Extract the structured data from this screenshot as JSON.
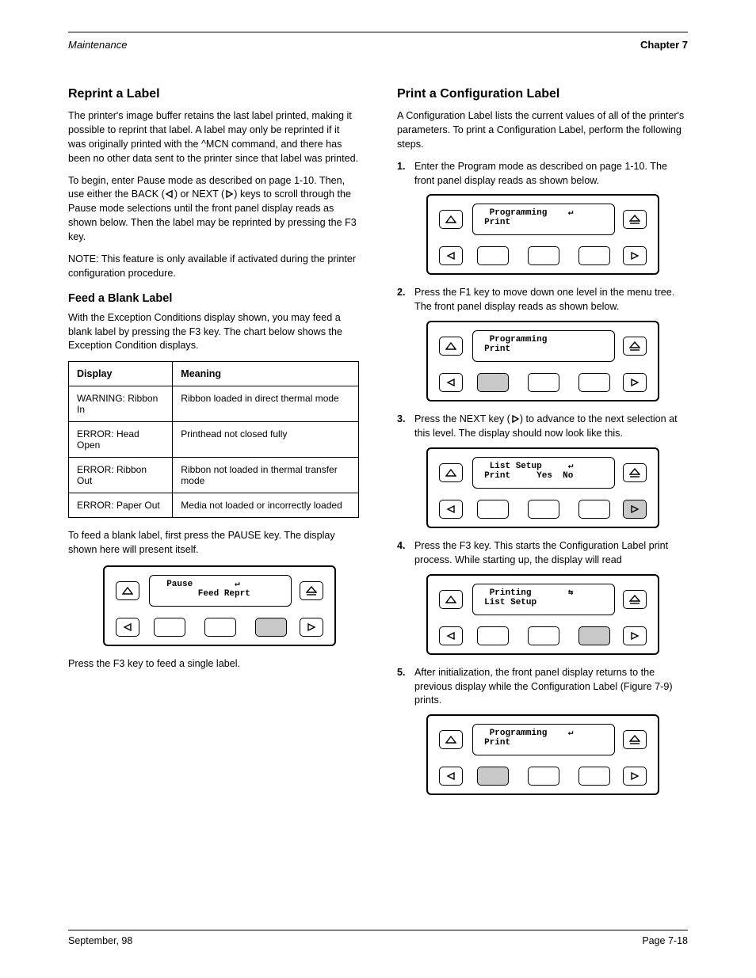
{
  "header": {
    "left": "Maintenance",
    "right": "Chapter 7"
  },
  "footer": {
    "date": "September, 98",
    "page": "Page 7-18"
  },
  "left_col": {
    "h2": "Reprint a Label",
    "p1": "The printer's image buffer retains the last label printed, making it possible to reprint that label. A label may only be reprinted if it was originally printed with the ^MCN command, and there has been no other data sent to the printer since that label was printed.",
    "p2_a": "To begin, enter Pause mode as described on page 1-10. Then, use either the BACK (",
    "p2_b": ") or NEXT (",
    "p2_c": ") keys to scroll through the Pause mode selections until the front panel display reads as shown below. Then the label may be reprinted by pressing the F3 key.",
    "note": "NOTE: This feature is only available if activated during the printer configuration procedure.",
    "h3": "Feed a Blank Label",
    "p3": "With the Exception Conditions display shown, you may feed a blank label by pressing the F3 key. The chart below shows the Exception Condition displays.",
    "table": {
      "headers": [
        "Display",
        "Meaning"
      ],
      "rows": [
        [
          "WARNING: Ribbon In",
          "Ribbon loaded in direct thermal mode"
        ],
        [
          "ERROR: Head Open",
          "Printhead not closed fully"
        ],
        [
          "ERROR: Ribbon Out",
          "Ribbon not loaded in thermal transfer mode"
        ],
        [
          "ERROR: Paper Out",
          "Media not loaded or incorrectly loaded"
        ]
      ]
    },
    "p4": "To feed a blank label, first press the PAUSE key. The display shown here will present itself.",
    "panel_left": {
      "lcd": "  Pause        ↵\n        Feed Reprt",
      "pressed": "f3"
    },
    "p5": "Press the F3 key to feed a single label."
  },
  "right_col": {
    "h2": "Print a Configuration Label",
    "p1": "A Configuration Label lists the current values of all of the printer's parameters. To print a Configuration Label, perform the following steps.",
    "steps": [
      {
        "n": "1.",
        "text": "Enter the Program mode as described on page 1-10. The front panel display reads as shown below.",
        "panel": {
          "lcd": "  Programming    ↵\n Print            ",
          "pressed": ""
        }
      },
      {
        "n": "2.",
        "text": "Press the F1 key to move down one level in the menu tree. The front panel display reads as shown below.",
        "panel": {
          "lcd": "  Programming     \n Print            ",
          "pressed": "f1"
        }
      },
      {
        "n": "3.",
        "text_a": "Press the NEXT key (",
        "text_b": ") to advance to the next selection at this level. The display should now look like this.",
        "panel": {
          "lcd": "  List Setup     ↵\n Print     Yes  No",
          "pressed": "right"
        }
      },
      {
        "n": "4.",
        "text": "Press the F3 key. This starts the Configuration Label print process. While starting up, the display will read",
        "panel": {
          "lcd": "  Printing       ⇆\n List Setup       ",
          "pressed": "f3"
        }
      },
      {
        "n": "5.",
        "text": "After initialization, the front panel display returns to the previous display while the Configuration Label (Figure 7-9) prints.",
        "panel": {
          "lcd": "  Programming    ↵\n Print            ",
          "pressed": "f1"
        }
      }
    ]
  }
}
